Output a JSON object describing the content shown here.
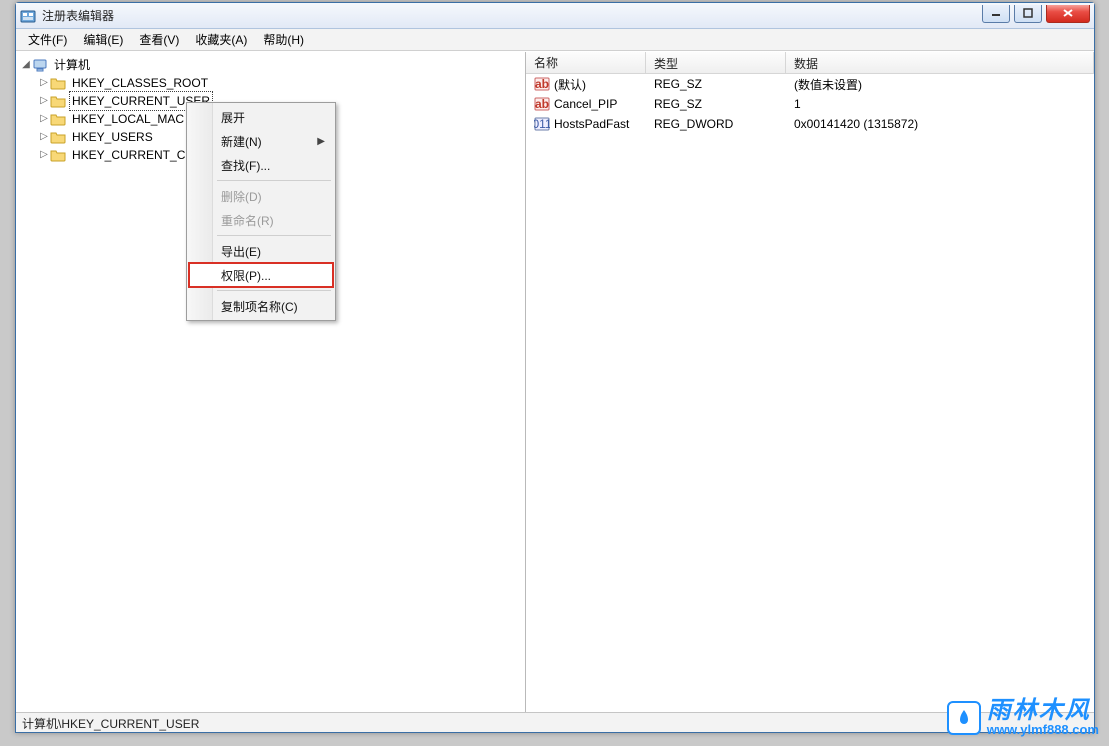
{
  "window": {
    "title": "注册表编辑器"
  },
  "menubar": {
    "file": "文件(F)",
    "edit": "编辑(E)",
    "view": "查看(V)",
    "fav": "收藏夹(A)",
    "help": "帮助(H)"
  },
  "tree": {
    "root": "计算机",
    "hkeys": [
      "HKEY_CLASSES_ROOT",
      "HKEY_CURRENT_USER",
      "HKEY_LOCAL_MACHINE",
      "HKEY_USERS",
      "HKEY_CURRENT_CONFIG"
    ],
    "hkeys_visible": [
      "HKEY_CLASSES_ROOT",
      "HKEY_CURRENT_USER",
      "HKEY_LOCAL_MAC",
      "HKEY_USERS",
      "HKEY_CURRENT_C"
    ],
    "selected_index": 1
  },
  "list": {
    "headers": {
      "name": "名称",
      "type": "类型",
      "data": "数据"
    },
    "rows": [
      {
        "icon": "reg-sz",
        "name": "(默认)",
        "type": "REG_SZ",
        "data": "(数值未设置)"
      },
      {
        "icon": "reg-sz",
        "name": "Cancel_PIP",
        "type": "REG_SZ",
        "data": "1"
      },
      {
        "icon": "reg-dword",
        "name": "HostsPadFast",
        "type": "REG_DWORD",
        "data": "0x00141420 (1315872)"
      }
    ]
  },
  "context_menu": {
    "expand": "展开",
    "new": "新建(N)",
    "find": "查找(F)...",
    "delete": "删除(D)",
    "rename": "重命名(R)",
    "export": "导出(E)",
    "perm": "权限(P)...",
    "copyname": "复制项名称(C)"
  },
  "statusbar": {
    "path": "计算机\\HKEY_CURRENT_USER"
  },
  "watermark": {
    "zh": "雨林木风",
    "url": "www.ylmf888.com"
  }
}
